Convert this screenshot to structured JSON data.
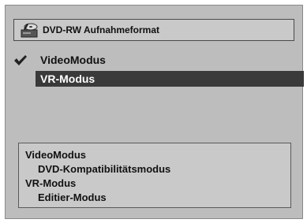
{
  "header": {
    "title": "DVD-RW Aufnahmeformat",
    "icon": "disc-recorder-icon"
  },
  "menu": {
    "items": [
      {
        "label": "VideoModus",
        "checked": true,
        "selected": false
      },
      {
        "label": "VR-Modus",
        "checked": false,
        "selected": true
      }
    ],
    "check_icon": "checkmark-icon"
  },
  "description": {
    "lines": [
      "VideoModus",
      "DVD-Kompatibilitätsmodus",
      "VR-Modus",
      "Editier-Modus"
    ]
  },
  "colors": {
    "background": "#bdbdbd",
    "highlight": "#3a3a3a",
    "highlight_text": "#ffffff"
  }
}
